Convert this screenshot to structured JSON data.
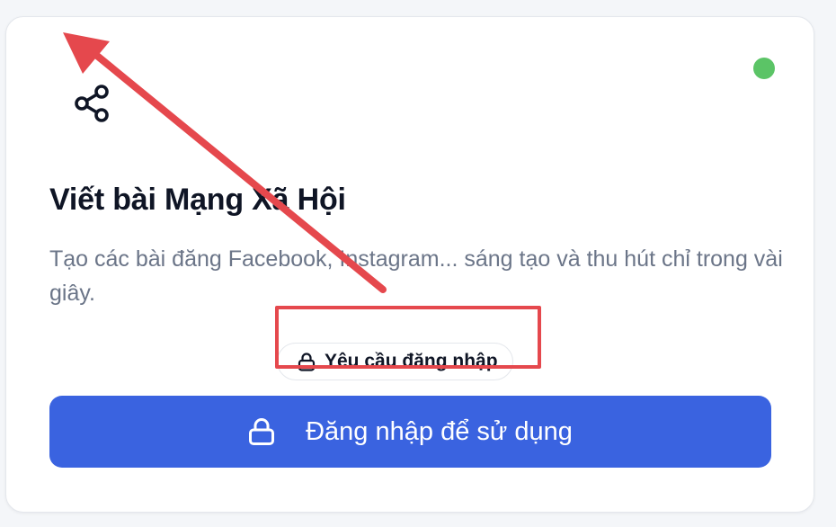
{
  "card": {
    "title": "Viết bài Mạng Xã Hội",
    "description": "Tạo các bài đăng Facebook, Instagram... sáng tạo và thu hút chỉ trong vài giây.",
    "icon": "share-icon",
    "status": {
      "color": "#5bc466"
    },
    "badge": {
      "icon": "lock-icon",
      "label": "Yêu cầu đăng nhập"
    },
    "login_button": {
      "icon": "lock-icon",
      "label": "Đăng nhập để sử dụng",
      "color": "#3a63e0"
    }
  },
  "annotations": {
    "color": "#e5484d",
    "highlight_target": "badge",
    "arrow_direction": "up-left"
  }
}
